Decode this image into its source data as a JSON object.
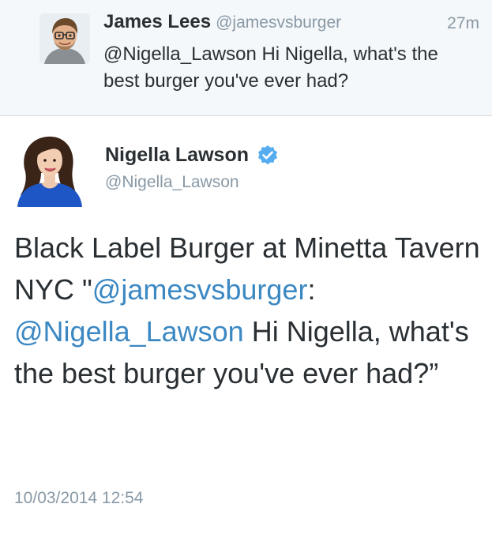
{
  "reply": {
    "name": "James Lees",
    "handle": "@jamesvsburger",
    "time": "27m",
    "text": "@Nigella_Lawson Hi Nigella, what's the best burger you've ever had?"
  },
  "main": {
    "name": "Nigella Lawson",
    "handle": "@Nigella_Lawson",
    "verified_icon": "verified-badge-icon",
    "text_part1": "Black Label Burger at Minetta Tavern NYC ",
    "text_quote_open": "\"",
    "text_mention1": "@jamesvsburger",
    "text_colon": ": ",
    "text_mention2": "@Nigella_Lawson",
    "text_part2": " Hi Nigella, what's the best burger you've ever had?”",
    "timestamp": "10/03/2014 12:54"
  },
  "colors": {
    "link": "#3b88c3",
    "muted": "#8899a6",
    "text": "#292f33",
    "verified": "#55acee"
  }
}
